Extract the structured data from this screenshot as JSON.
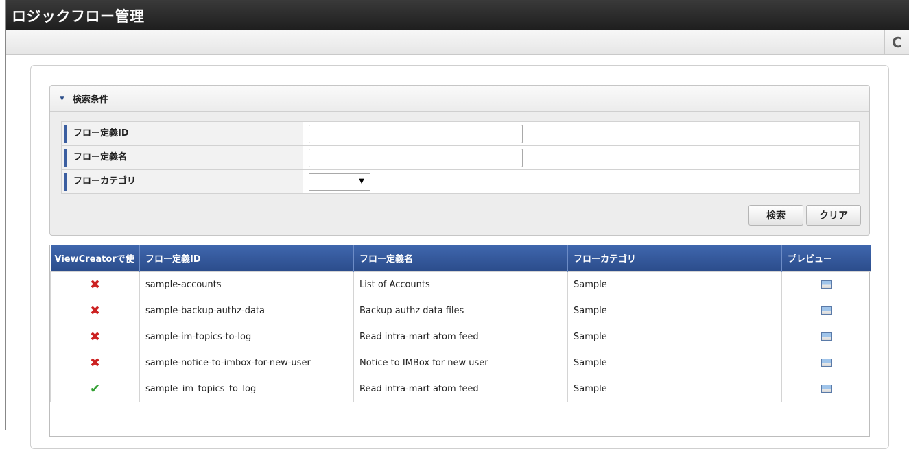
{
  "app": {
    "title": "ロジックフロー管理"
  },
  "toolbar": {
    "refresh_icon": "refresh-icon",
    "refresh_glyph": "C"
  },
  "search": {
    "section_label": "検索条件",
    "fields": [
      {
        "label": "フロー定義ID",
        "value": "",
        "placeholder": ""
      },
      {
        "label": "フロー定義名",
        "value": "",
        "placeholder": ""
      },
      {
        "label": "フローカテゴリ",
        "selected": ""
      }
    ],
    "search_button": "検索",
    "clear_button": "クリア"
  },
  "grid": {
    "columns": [
      "ViewCreatorで使",
      "フロー定義ID",
      "フロー定義名",
      "フローカテゴリ",
      "プレビュー"
    ],
    "rows": [
      {
        "usable": false,
        "id": "sample-accounts",
        "name": "List of Accounts",
        "category": "Sample"
      },
      {
        "usable": false,
        "id": "sample-backup-authz-data",
        "name": "Backup authz data files",
        "category": "Sample"
      },
      {
        "usable": false,
        "id": "sample-im-topics-to-log",
        "name": "Read intra-mart atom feed",
        "category": "Sample"
      },
      {
        "usable": false,
        "id": "sample-notice-to-imbox-for-new-user",
        "name": "Notice to IMBox for new user",
        "category": "Sample"
      },
      {
        "usable": true,
        "id": "sample_im_topics_to_log",
        "name": "Read intra-mart atom feed",
        "category": "Sample"
      }
    ]
  },
  "colors": {
    "header_blue": "#2b4c8b",
    "x_red": "#cc2222",
    "check_green": "#33a033"
  }
}
